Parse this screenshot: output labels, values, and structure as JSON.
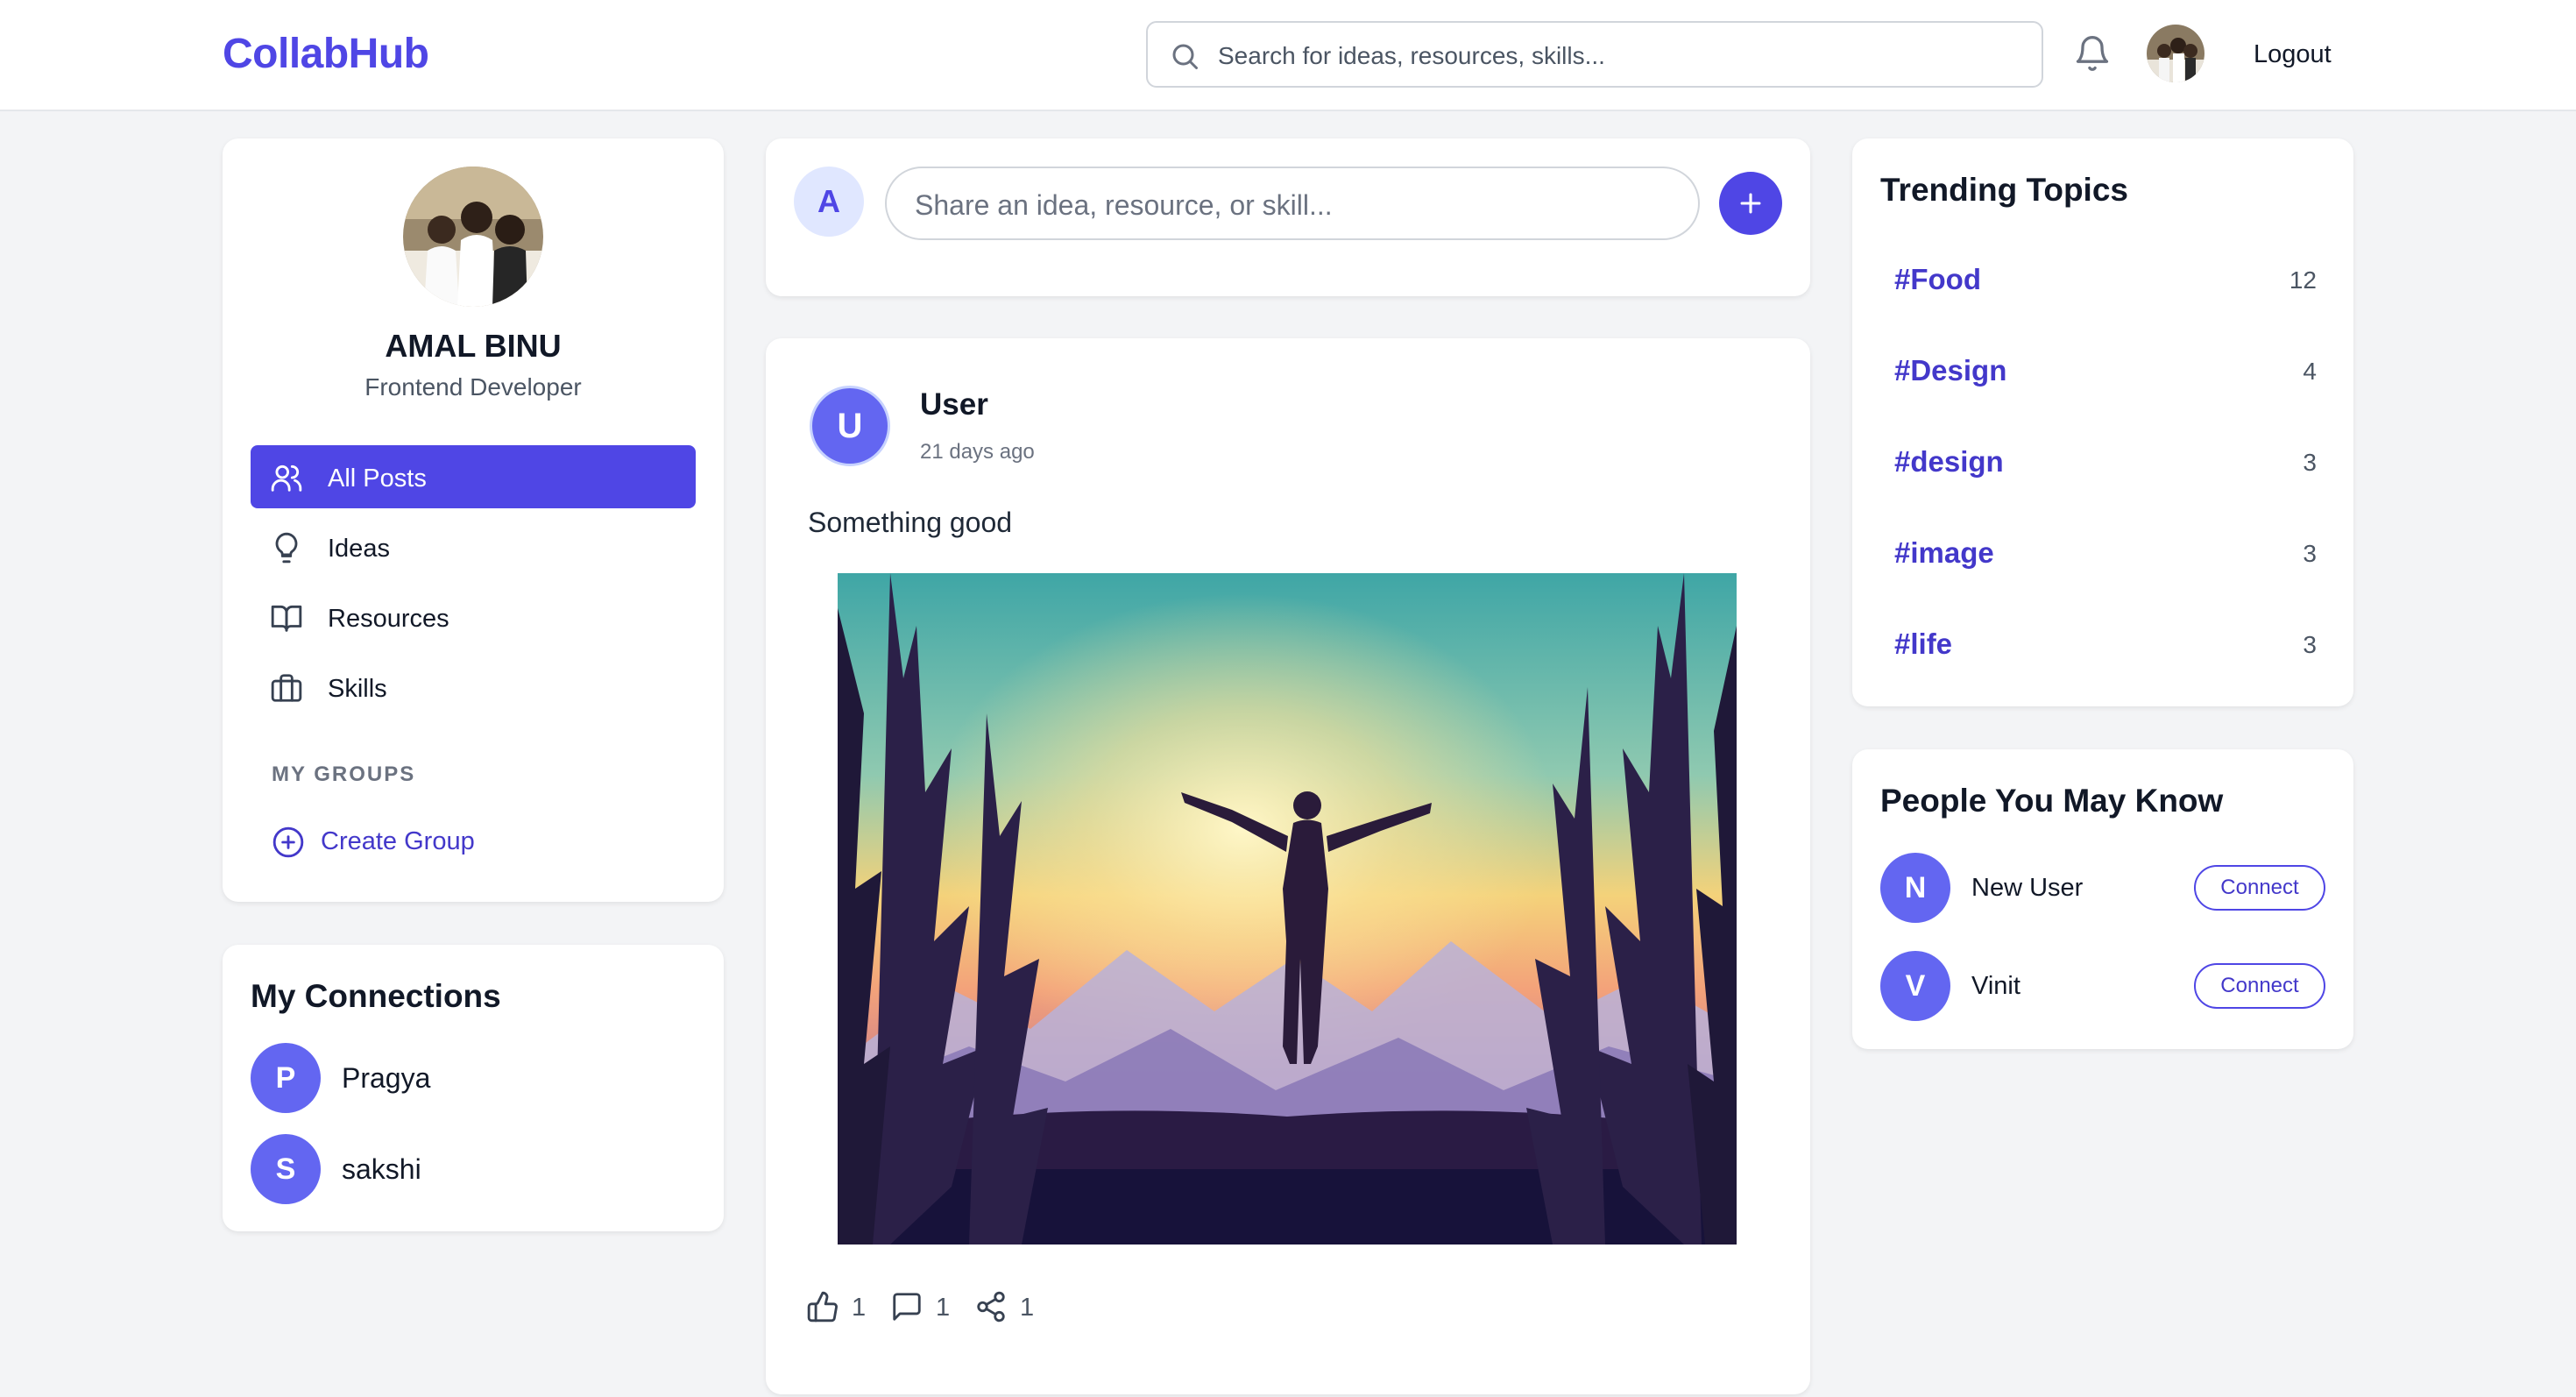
{
  "app": {
    "logo": "CollabHub"
  },
  "header": {
    "search_placeholder": "Search for ideas, resources, skills...",
    "logout_label": "Logout"
  },
  "profile": {
    "name": "AMAL BINU",
    "role": "Frontend Developer"
  },
  "nav": {
    "items": [
      {
        "label": "All Posts",
        "icon": "users-icon",
        "active": true
      },
      {
        "label": "Ideas",
        "icon": "lightbulb-icon",
        "active": false
      },
      {
        "label": "Resources",
        "icon": "book-icon",
        "active": false
      },
      {
        "label": "Skills",
        "icon": "briefcase-icon",
        "active": false
      }
    ],
    "groups_title": "MY GROUPS",
    "create_group_label": "Create Group"
  },
  "connections": {
    "title": "My Connections",
    "items": [
      {
        "initial": "P",
        "name": "Pragya"
      },
      {
        "initial": "S",
        "name": "sakshi"
      }
    ]
  },
  "composer": {
    "avatar_initial": "A",
    "placeholder": "Share an idea, resource, or skill..."
  },
  "post": {
    "avatar_initial": "U",
    "user": "User",
    "time": "21 days ago",
    "text": "Something good",
    "likes": "1",
    "comments": "1",
    "shares": "1"
  },
  "trending": {
    "title": "Trending Topics",
    "topics": [
      {
        "tag": "#Food",
        "count": "12"
      },
      {
        "tag": "#Design",
        "count": "4"
      },
      {
        "tag": "#design",
        "count": "3"
      },
      {
        "tag": "#image",
        "count": "3"
      },
      {
        "tag": "#life",
        "count": "3"
      }
    ]
  },
  "people": {
    "title": "People You May Know",
    "items": [
      {
        "initial": "N",
        "name": "New User",
        "button": "Connect"
      },
      {
        "initial": "V",
        "name": "Vinit",
        "button": "Connect"
      }
    ]
  },
  "colors": {
    "accent": "#4f46e5",
    "avatar_bg": "#6366f1",
    "page_bg": "#f3f4f6"
  }
}
